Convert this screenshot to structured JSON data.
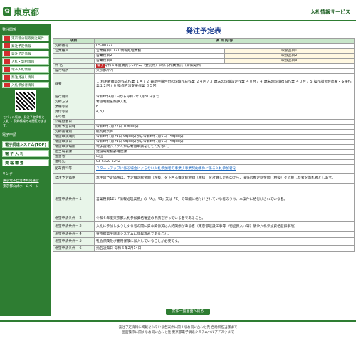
{
  "header": {
    "logo_text": "東京都",
    "system_title": "入札情報サービス"
  },
  "sidebar": {
    "section1": "発注関係",
    "items": [
      "東京都公報等発注案件",
      "発注予定情報",
      "発注予定情報",
      "入札・契約情報",
      "電子入札情報",
      "発注見通し情報",
      "入札参加者情報"
    ],
    "qr_note": "モバイル版は、発注予定情報と 入札 ・ 契約情報のみ閲覧できます。",
    "section2": "電子申請",
    "buttons": [
      "電子調達システム(TOP)",
      "電 子 入 札",
      "資 格 審 査"
    ],
    "section3": "リンク",
    "links": [
      "東京電子自治体共同運営",
      "東京都公式ホームページ"
    ]
  },
  "main": {
    "title": "発注予定表",
    "col_item": "項目",
    "col_content": "項 目 内 容",
    "rows": [
      {
        "label": "契約番号",
        "value": "05-00727"
      },
      {
        "label": "営業種目",
        "value": "営業種目1 121 情報処理業務",
        "sub": "取扱品目1"
      },
      {
        "label": "",
        "value": "営業種目2",
        "sub": "取扱品目2"
      },
      {
        "label": "",
        "value": "営業種目3",
        "sub": "取扱品目3"
      },
      {
        "label": "件 名",
        "badge": "電子",
        "value": "令和６年度購買システム（委託用）に係る作業委託（単価契約）"
      },
      {
        "label": "履行場所",
        "value": "東京都庁内"
      },
      {
        "label": "概要",
        "value": "１ 利用者確認の作成作業 １回 / ２ 最新申請台付の環境作成作業 ２４回 / ３ 端末の環境設定作業 ４０台 / ４ 端末の環境復旧作業 ４０台 / ５ 操作講習会準備・支援作業１２回 / ６ 操作方法支援作業 ３５回"
      },
      {
        "label": "履行期間",
        "value": "令和6年4月1日から令和7年3月31日まで"
      },
      {
        "label": "契約方法",
        "value": "希望制指名競争入札"
      },
      {
        "label": "業種等級",
        "value": "B"
      },
      {
        "label": "受付等級",
        "value": "A,B,C"
      },
      {
        "label": "その他",
        "value": ""
      },
      {
        "label": "公報登載日",
        "value": ""
      },
      {
        "label": "開札予定日時",
        "value": "令和6年2月22日 10時00分"
      },
      {
        "label": "契約書種別",
        "value": "統契約案件"
      },
      {
        "label": "希望申請期間",
        "value": "令和6年1月29日 9時00分から令和6年2月5日 15時00分"
      },
      {
        "label": "希望申請日",
        "value": "令和6年1月29日 9時00分から令和6年2月5日 15時00分"
      },
      {
        "label": "希望申請場所",
        "value": "電子調達システムから希望申請をしてください。"
      },
      {
        "label": "担当局部課",
        "value": "建設局総務部用度課"
      },
      {
        "label": "担当者",
        "value": "山田"
      },
      {
        "label": "連絡先",
        "value": "03-5320-5242"
      },
      {
        "label": "配布資料等",
        "value": "スタートアップに係る場合によらない入札参加者の事業 / 事業契約事件に係る入札参加者を"
      },
      {
        "label": "発注予定価格",
        "value": "本件の予定価格は、予定推定総金額（税抜）を下回る推定総金額（税抜）を計算したものから、最低の推定総金額（税抜）を計算した者を落札者とします。"
      },
      {
        "label": "希望申請条件－１",
        "value": "営業種目121「情報処理業務」の「A」、「B」又は「C」の等級に格付けされている者のうち、本案件に格付けされている者。"
      },
      {
        "label": "希望申請条件－２",
        "value": "令和６年度東京都入札参加資格審査の申請を行っている者であること。"
      },
      {
        "label": "希望申請条件－３",
        "value": "入札に参加しようとする者の間に資本関係又は人的関係がある者（東京都建設工事等（物品買入れ等）競争入札参加資格登録事項）"
      },
      {
        "label": "希望申請条件－４",
        "value": "東京都電子調達システムに登録済みであること。"
      },
      {
        "label": "希望申請条件－５",
        "value": "社会保険及び雇用保険に加入していることが必要です。"
      },
      {
        "label": "希望申請条件－６",
        "value": "指名通知日 令和６年2月14日"
      }
    ],
    "back_button": "案件一覧画面へ戻る"
  },
  "footer": {
    "line1": "発注予定情報に掲載されている各案件に関するお問い合わせ先 各局所担当課まで",
    "line2": "画面操作に関するお問い合わせ先 東京都電子調達システムヘルプデスクまで"
  },
  "colors": {
    "brand": "#2e7d32",
    "title": "#1b3d8f"
  }
}
